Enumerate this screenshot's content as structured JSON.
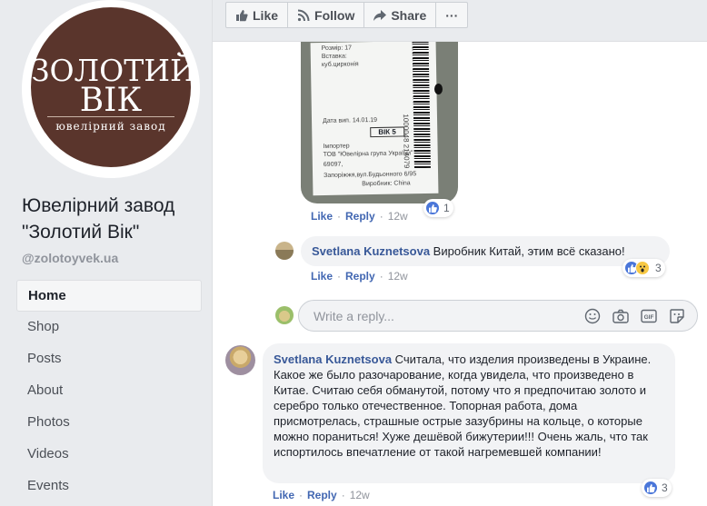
{
  "page": {
    "logo_line1": "ЗОЛОТИЙ",
    "logo_line2": "ВІК",
    "logo_sub": "ювелірний завод",
    "name": "Ювелірний завод \"Золотий Вік\"",
    "handle": "@zolotoyvek.ua"
  },
  "sidebar": {
    "items": [
      {
        "label": "Home",
        "active": true
      },
      {
        "label": "Shop"
      },
      {
        "label": "Posts"
      },
      {
        "label": "About"
      },
      {
        "label": "Photos"
      },
      {
        "label": "Videos"
      },
      {
        "label": "Events"
      }
    ]
  },
  "actions": {
    "like": "Like",
    "follow": "Follow",
    "share": "Share",
    "more": "···"
  },
  "photo": {
    "size": "Розмір: 17",
    "insert": "Вставка:",
    "stone": "куб.цирконія",
    "date": "Дата вип. 14.01.19",
    "brand": "ВІК 5",
    "importer": "Імпортер",
    "company": "ТОВ \"Ювелірна група України\"",
    "zip": "69097,",
    "address": "Запоріжжя,вул.Будьонного 6/95",
    "maker": "Виробник: China",
    "barcode": "1000048 214079"
  },
  "comment1": {
    "like": "Like",
    "reply": "Reply",
    "time": "12w",
    "reactions": "1"
  },
  "comment2": {
    "author": "Svetlana Kuznetsova",
    "text": "Виробник Китай, этим всё сказано!",
    "like": "Like",
    "reply": "Reply",
    "time": "12w",
    "reactions": "3"
  },
  "reply_box": {
    "placeholder": "Write a reply..."
  },
  "comment3": {
    "author": "Svetlana Kuznetsova",
    "text": "Считала, что изделия произведены в Украине. Какое же было разочарование, когда увидела, что произведено в Китае. Считаю себя обманутой, потому что я предпочитаю золото и серебро только отечественное. Топорная работа, дома присмотрелась, страшные острые зазубрины на кольце, о которые можно пораниться! Хуже дешёвой бижутерии!!! Очень жаль, что так испортилось впечатление от такой нагремевшей компании!",
    "like": "Like",
    "reply": "Reply",
    "time": "12w",
    "reactions": "3"
  },
  "colors": {
    "link": "#385898",
    "action_link": "#4267b2",
    "logo_bg": "#5a352c"
  }
}
